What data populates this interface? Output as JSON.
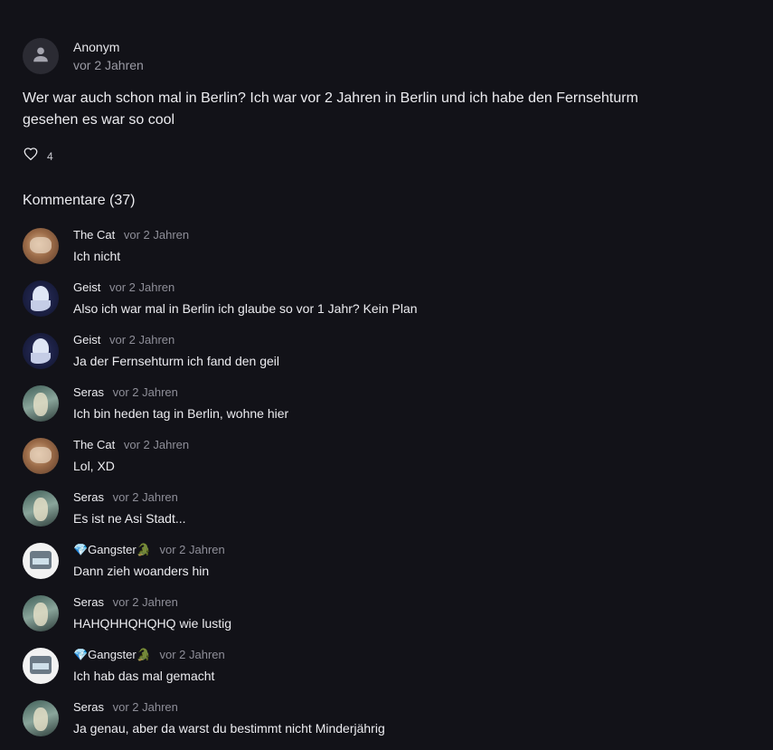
{
  "post": {
    "author": "Anonym",
    "time": "vor 2 Jahren",
    "body": "Wer war auch schon mal in Berlin? Ich war vor 2 Jahren in Berlin und ich habe den Fernsehturm gesehen es war so cool",
    "likes": "4"
  },
  "comments_header": "Kommentare (37)",
  "comments": [
    {
      "name": "The Cat",
      "time": "vor 2 Jahren",
      "text": "Ich nicht",
      "avatar": "cat"
    },
    {
      "name": "Geist",
      "time": "vor 2 Jahren",
      "text": "Also ich war mal in Berlin ich glaube so vor 1 Jahr? Kein Plan",
      "avatar": "geist"
    },
    {
      "name": "Geist",
      "time": "vor 2 Jahren",
      "text": "Ja der Fernsehturm ich fand den geil",
      "avatar": "geist"
    },
    {
      "name": "Seras",
      "time": "vor 2 Jahren",
      "text": "Ich bin heden tag in Berlin, wohne hier",
      "avatar": "seras"
    },
    {
      "name": "The Cat",
      "time": "vor 2 Jahren",
      "text": "Lol, XD",
      "avatar": "cat"
    },
    {
      "name": "Seras",
      "time": "vor 2 Jahren",
      "text": "Es ist ne Asi Stadt...",
      "avatar": "seras"
    },
    {
      "name": "💎Gangster🐊",
      "time": "vor 2 Jahren",
      "text": "Dann zieh woanders hin",
      "avatar": "gangster"
    },
    {
      "name": "Seras",
      "time": "vor 2 Jahren",
      "text": "HAHQHHQHQHQ wie lustig",
      "avatar": "seras"
    },
    {
      "name": "💎Gangster🐊",
      "time": "vor 2 Jahren",
      "text": "Ich hab das mal gemacht",
      "avatar": "gangster"
    },
    {
      "name": "Seras",
      "time": "vor 2 Jahren",
      "text": "Ja genau, aber da warst du bestimmt nicht Minderjährig",
      "avatar": "seras"
    }
  ],
  "icons": {
    "anon_avatar": "person-icon",
    "like": "heart-outline-icon"
  },
  "colors": {
    "background": "#121218",
    "text": "#ececf0",
    "muted": "#8e8e98"
  }
}
